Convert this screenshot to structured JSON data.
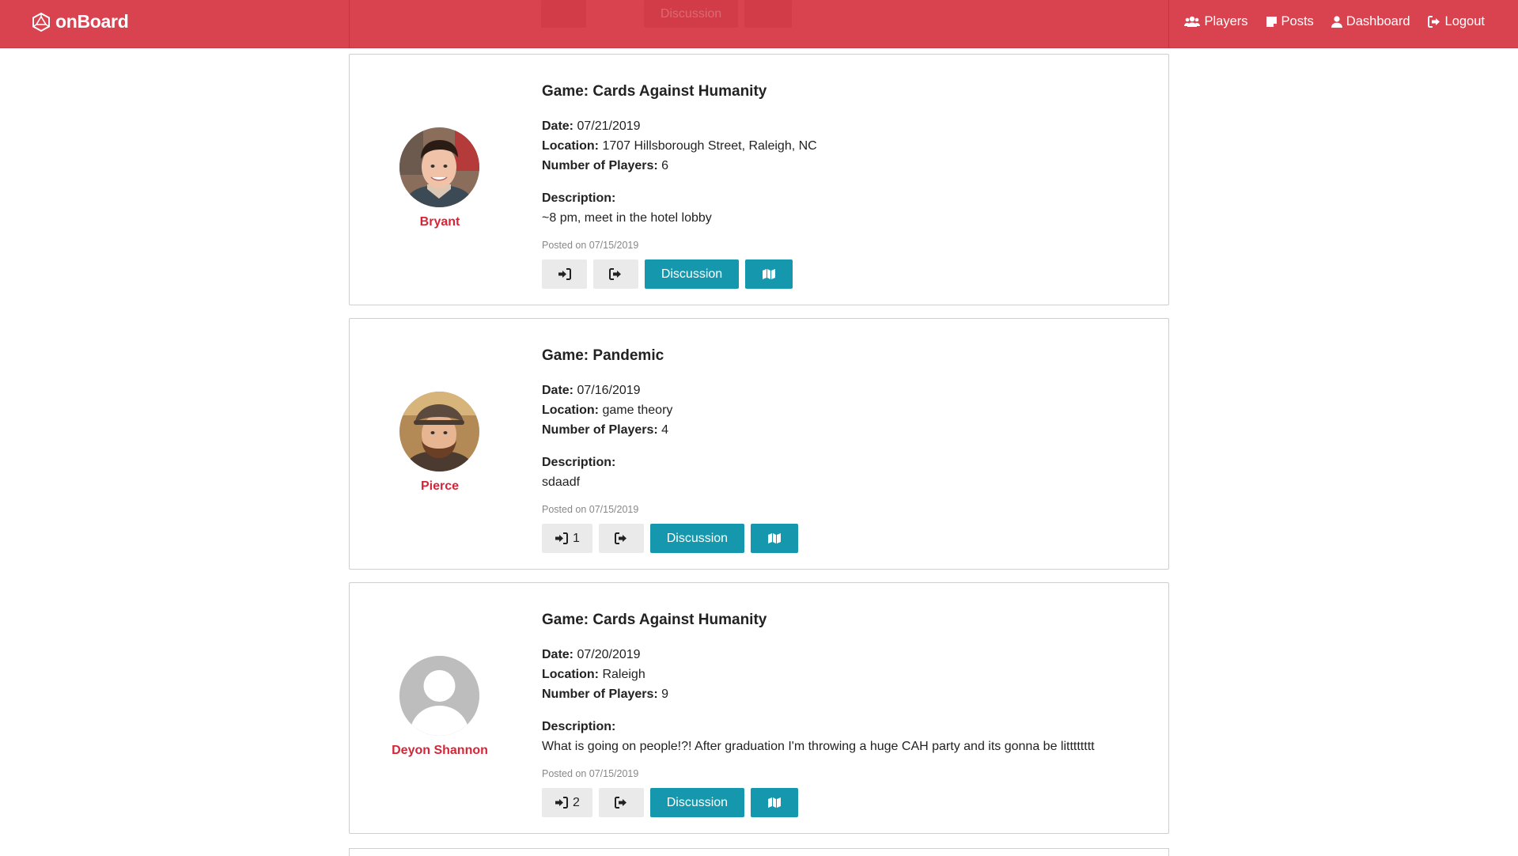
{
  "navbar": {
    "brand": "onBoard",
    "links": [
      {
        "label": "Players",
        "icon": "users-icon"
      },
      {
        "label": "Posts",
        "icon": "sticky-note-icon"
      },
      {
        "label": "Dashboard",
        "icon": "user-icon"
      },
      {
        "label": "Logout",
        "icon": "sign-out-icon"
      }
    ]
  },
  "ghost": {
    "discussion_label": "Discussion"
  },
  "posts": [
    {
      "author": "Bryant",
      "avatar": "photo",
      "game_label": "Game: Cards Against Humanity",
      "date_label": "Date:",
      "date": "07/21/2019",
      "location_label": "Location:",
      "location": "1707 Hillsborough Street, Raleigh, NC",
      "players_label": "Number of Players:",
      "players": "6",
      "description_label": "Description:",
      "description": "~8 pm, meet in the hotel lobby",
      "posted": "Posted on 07/15/2019",
      "join_count": "",
      "discussion_label": "Discussion"
    },
    {
      "author": "Pierce",
      "avatar": "photo",
      "game_label": "Game: Pandemic",
      "date_label": "Date:",
      "date": "07/16/2019",
      "location_label": "Location:",
      "location": "game theory",
      "players_label": "Number of Players:",
      "players": "4",
      "description_label": "Description:",
      "description": "sdaadf",
      "posted": "Posted on 07/15/2019",
      "join_count": "1",
      "discussion_label": "Discussion"
    },
    {
      "author": "Deyon Shannon",
      "avatar": "default",
      "game_label": "Game: Cards Against Humanity",
      "date_label": "Date:",
      "date": "07/20/2019",
      "location_label": "Location:",
      "location": "Raleigh",
      "players_label": "Number of Players:",
      "players": "9",
      "description_label": "Description:",
      "description": "What is going on people!?! After graduation I'm throwing a huge CAH party and its gonna be litttttttt",
      "posted": "Posted on 07/15/2019",
      "join_count": "2",
      "discussion_label": "Discussion"
    }
  ],
  "colors": {
    "navbar": "#d9434f",
    "author": "#d42638",
    "teal": "#1597ad"
  }
}
